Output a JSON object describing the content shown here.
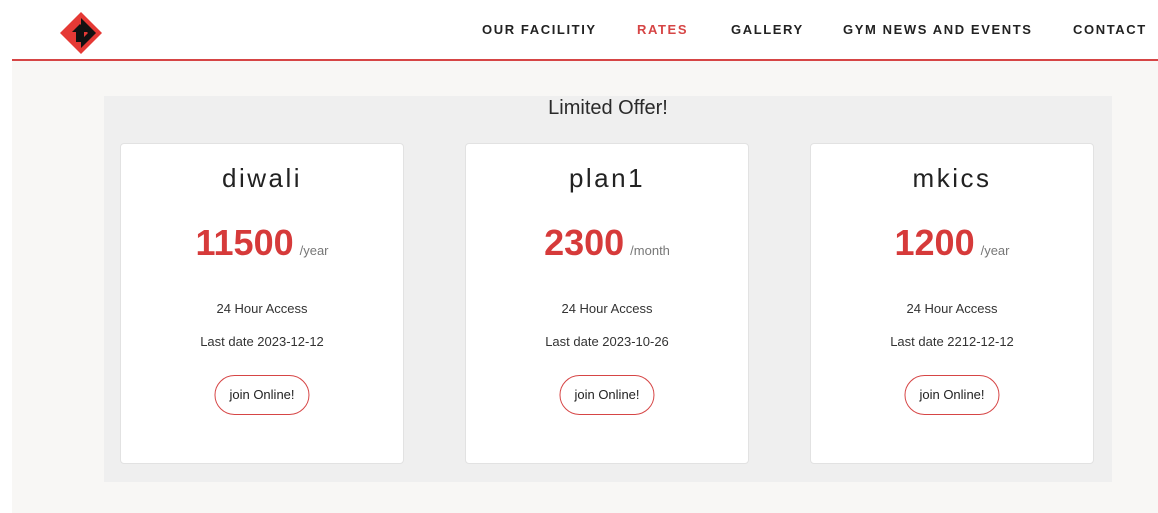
{
  "header": {
    "logo_icon": "brand-logo-icon",
    "brand_color": "#d64545",
    "nav": [
      {
        "label": "OUR FACILITIY",
        "active": false
      },
      {
        "label": "RATES",
        "active": true
      },
      {
        "label": "GALLERY",
        "active": false
      },
      {
        "label": "GYM NEWS AND EVENTS",
        "active": false
      },
      {
        "label": "CONTACT",
        "active": false
      }
    ]
  },
  "offers": {
    "title": "Limited Offer!",
    "plans": [
      {
        "name": "diwali",
        "price": "11500",
        "period": "/year",
        "feature": "24 Hour Access",
        "last_date": "Last date 2023-12-12",
        "button_label": "join Online!"
      },
      {
        "name": "plan1",
        "price": "2300",
        "period": "/month",
        "feature": "24 Hour Access",
        "last_date": "Last date 2023-10-26",
        "button_label": "join Online!"
      },
      {
        "name": "mkics",
        "price": "1200",
        "period": "/year",
        "feature": "24 Hour Access",
        "last_date": "Last date 2212-12-12",
        "button_label": "join Online!"
      }
    ]
  },
  "colors": {
    "accent": "#d64545",
    "price": "#d63a3a",
    "page_bg": "#f8f7f5",
    "panel_bg": "#efefef"
  }
}
